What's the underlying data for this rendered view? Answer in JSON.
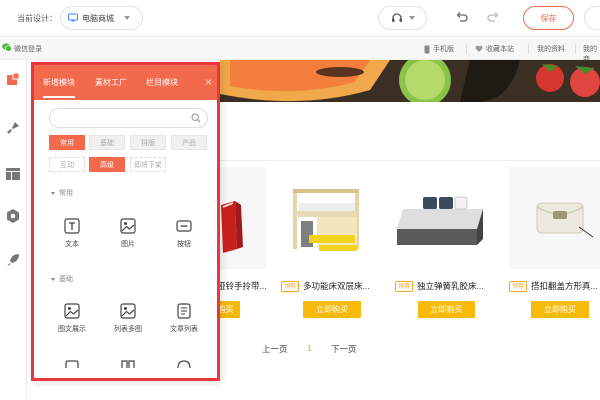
{
  "topbar": {
    "current_design_label": "当前设计：",
    "device_select_value": "电脑商城",
    "save_label": "保存"
  },
  "site_strip": {
    "wechat_login": "微信登录",
    "links": [
      "手机版",
      "收藏本站",
      "我的资料",
      "我的商"
    ]
  },
  "panel": {
    "tabs": [
      "新增模块",
      "素材工厂",
      "栏目模块"
    ],
    "active_tab": 0,
    "close_glyph": "×",
    "search_value": "",
    "chips_row1": [
      "常用",
      "基础",
      "排版",
      "产品"
    ],
    "chips_row2": [
      "互动",
      "高级",
      "即将下架"
    ],
    "active_chips": [
      "常用",
      "高级"
    ],
    "groups": [
      {
        "title": "常用",
        "items": [
          "文本",
          "图片",
          "按钮"
        ]
      },
      {
        "title": "基础",
        "items": [
          "图文展示",
          "列表多图",
          "文章列表"
        ]
      }
    ]
  },
  "products": [
    {
      "coupon": "",
      "title": "哑铃手拎带...",
      "buy_label": "立即购买"
    },
    {
      "coupon": "领券",
      "title": "多功能床双层床...",
      "buy_label": "立即购买"
    },
    {
      "coupon": "领券",
      "title": "独立弹簧乳胶床...",
      "buy_label": "立即购买"
    },
    {
      "coupon": "领券",
      "title": "搭扣翻盖方形真...",
      "buy_label": "立即购买"
    }
  ],
  "pager": {
    "prev": "上一页",
    "current": "1",
    "next": "下一页"
  },
  "colors": {
    "accent": "#f26a4b",
    "panel_border": "#e8383d",
    "buy_button": "#f7b90a",
    "coupon": "#f5a623"
  }
}
